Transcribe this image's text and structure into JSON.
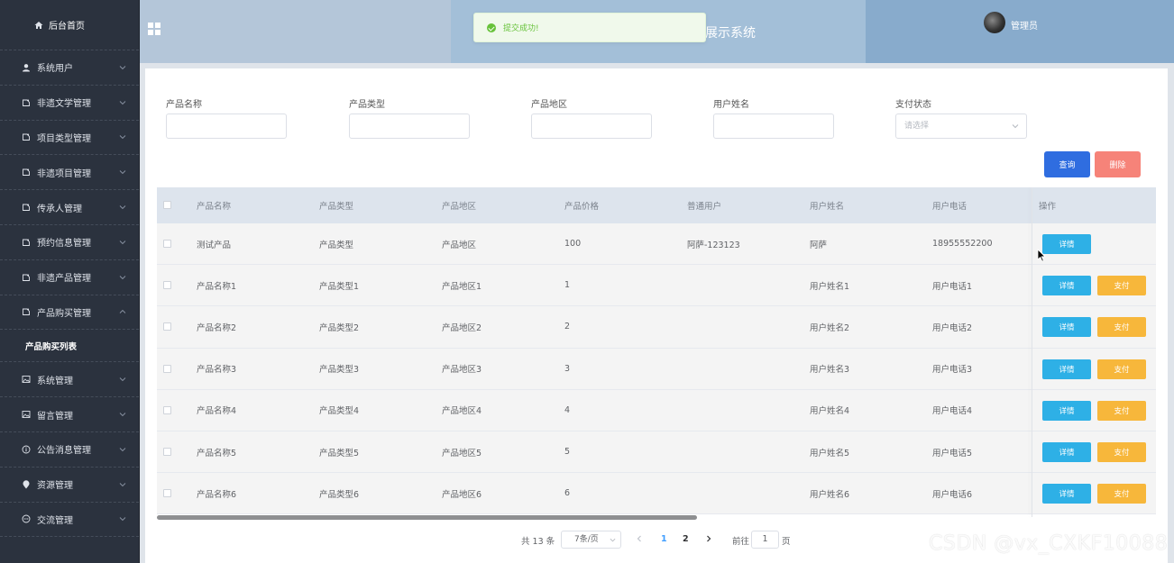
{
  "sidebar": {
    "home_label": "后台首页",
    "items": [
      {
        "label": "系统用户",
        "icon": "user-icon"
      },
      {
        "label": "非遗文学管理",
        "icon": "tag-icon"
      },
      {
        "label": "项目类型管理",
        "icon": "tag-icon"
      },
      {
        "label": "非遗项目管理",
        "icon": "tag-icon"
      },
      {
        "label": "传承人管理",
        "icon": "tag-icon"
      },
      {
        "label": "预约信息管理",
        "icon": "tag-icon"
      },
      {
        "label": "非遗产品管理",
        "icon": "tag-icon"
      },
      {
        "label": "产品购买管理",
        "icon": "tag-icon"
      }
    ],
    "sub_item": "产品购买列表",
    "items_after": [
      {
        "label": "系统管理",
        "icon": "picture-icon"
      },
      {
        "label": "留言管理",
        "icon": "picture-icon"
      },
      {
        "label": "公告消息管理",
        "icon": "info-icon"
      },
      {
        "label": "资源管理",
        "icon": "location-icon"
      },
      {
        "label": "交流管理",
        "icon": "chat-icon"
      }
    ]
  },
  "header": {
    "system_title": "展示系统",
    "admin_name": "管理员",
    "toast_message": "提交成功!"
  },
  "search": {
    "fields": [
      {
        "label": "产品名称",
        "value": ""
      },
      {
        "label": "产品类型",
        "value": ""
      },
      {
        "label": "产品地区",
        "value": ""
      },
      {
        "label": "用户姓名",
        "value": ""
      }
    ],
    "pay_status_label": "支付状态",
    "pay_status_placeholder": "请选择",
    "query_label": "查询",
    "delete_label": "删除"
  },
  "table": {
    "columns": [
      "产品名称",
      "产品类型",
      "产品地区",
      "产品价格",
      "普通用户",
      "用户姓名",
      "用户电话",
      "操作"
    ],
    "rows": [
      {
        "name": "测试产品",
        "type": "产品类型",
        "region": "产品地区",
        "price": "100",
        "user": "阿萨-123123",
        "username": "阿萨",
        "phone": "18955552200",
        "pay": false
      },
      {
        "name": "产品名称1",
        "type": "产品类型1",
        "region": "产品地区1",
        "price": "1",
        "user": "",
        "username": "用户姓名1",
        "phone": "用户电话1",
        "pay": true
      },
      {
        "name": "产品名称2",
        "type": "产品类型2",
        "region": "产品地区2",
        "price": "2",
        "user": "",
        "username": "用户姓名2",
        "phone": "用户电话2",
        "pay": true
      },
      {
        "name": "产品名称3",
        "type": "产品类型3",
        "region": "产品地区3",
        "price": "3",
        "user": "",
        "username": "用户姓名3",
        "phone": "用户电话3",
        "pay": true
      },
      {
        "name": "产品名称4",
        "type": "产品类型4",
        "region": "产品地区4",
        "price": "4",
        "user": "",
        "username": "用户姓名4",
        "phone": "用户电话4",
        "pay": true
      },
      {
        "name": "产品名称5",
        "type": "产品类型5",
        "region": "产品地区5",
        "price": "5",
        "user": "",
        "username": "用户姓名5",
        "phone": "用户电话5",
        "pay": true
      },
      {
        "name": "产品名称6",
        "type": "产品类型6",
        "region": "产品地区6",
        "price": "6",
        "user": "",
        "username": "用户姓名6",
        "phone": "用户电话6",
        "pay": true
      }
    ],
    "detail_label": "详情",
    "pay_label": "支付"
  },
  "pagination": {
    "total_text": "共 13 条",
    "page_size": "7条/页",
    "pages": [
      "1",
      "2"
    ],
    "current_page": "1",
    "goto_label": "前往",
    "goto_value": "1",
    "page_suffix": "页"
  },
  "watermark": "CSDN @vx_CXKF10088",
  "colors": {
    "sidebar_bg": "#2b323e",
    "query_button": "#2f6de0",
    "delete_button": "#f68379",
    "detail_button": "#2eb0e6",
    "pay_button": "#f7b73b",
    "success": "#67c23a",
    "active_page": "#409eff"
  }
}
